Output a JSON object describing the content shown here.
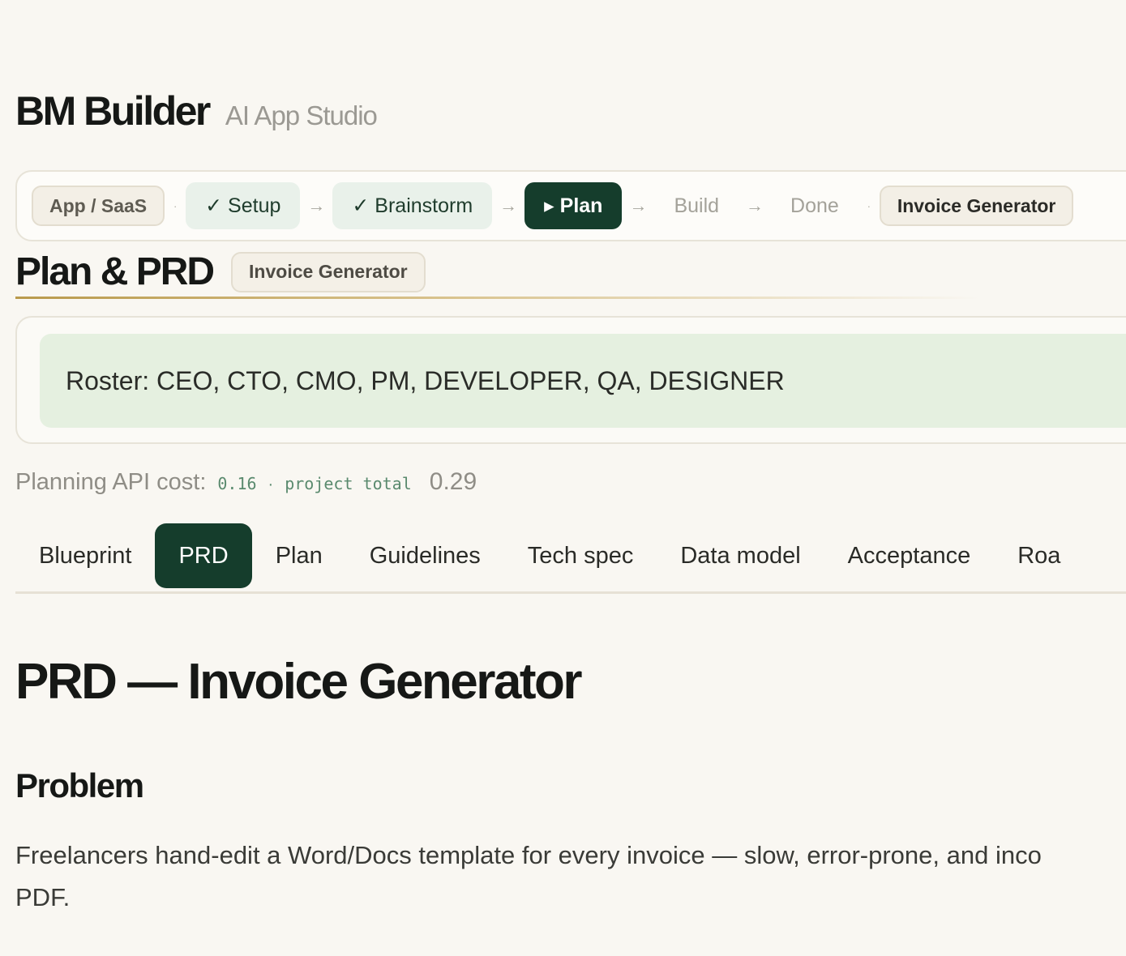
{
  "header": {
    "title": "BM Builder",
    "subtitle": "AI App Studio"
  },
  "stepper": {
    "category": "App / SaaS",
    "separator": "·",
    "arrow": "→",
    "steps": [
      {
        "label": "✓ Setup",
        "state": "done"
      },
      {
        "label": "✓ Brainstorm",
        "state": "done"
      },
      {
        "label": "▸ Plan",
        "state": "active"
      },
      {
        "label": "Build",
        "state": "pending"
      },
      {
        "label": "Done",
        "state": "pending"
      }
    ],
    "project": "Invoice Generator"
  },
  "plan": {
    "title": "Plan & PRD",
    "badge": "Invoice Generator"
  },
  "roster": {
    "text": "Roster: CEO, CTO, CMO, PM, DEVELOPER, QA, DESIGNER"
  },
  "cost": {
    "label": "Planning API cost:",
    "value": "0.16",
    "dot": "·",
    "total_label": "project total",
    "total_value": "0.29"
  },
  "tabs": [
    {
      "label": "Blueprint",
      "active": false
    },
    {
      "label": "PRD",
      "active": true
    },
    {
      "label": "Plan",
      "active": false
    },
    {
      "label": "Guidelines",
      "active": false
    },
    {
      "label": "Tech spec",
      "active": false
    },
    {
      "label": "Data model",
      "active": false
    },
    {
      "label": "Acceptance",
      "active": false
    },
    {
      "label": "Roa",
      "active": false
    }
  ],
  "doc": {
    "title": "PRD — Invoice Generator",
    "sections": [
      {
        "heading": "Problem",
        "lines": [
          "Freelancers hand-edit a Word/Docs template for every invoice — slow, error-prone, and inco",
          "PDF."
        ]
      }
    ]
  },
  "colors": {
    "background": "#f9f7f2",
    "accent": "#153d2c",
    "done_step": "#e9f1ea",
    "roster_bg": "#e5f0e0",
    "gold": "#b99a4c"
  }
}
